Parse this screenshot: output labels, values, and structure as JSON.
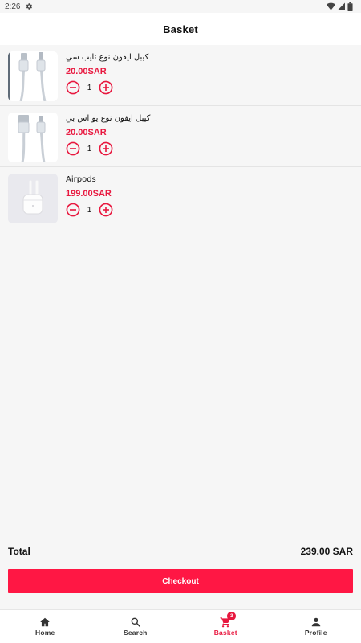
{
  "status_bar": {
    "time": "2:26"
  },
  "header": {
    "title": "Basket"
  },
  "cart": {
    "items": [
      {
        "name": "كيبل ايفون نوع تايب سي",
        "price": "20.00SAR",
        "quantity": "1",
        "image": "cable-usb-c-image"
      },
      {
        "name": "كيبل ايفون نوع يو اس بي",
        "price": "20.00SAR",
        "quantity": "1",
        "image": "cable-usb-a-image"
      },
      {
        "name": "Airpods",
        "price": "199.00SAR",
        "quantity": "1",
        "image": "airpods-image"
      }
    ]
  },
  "summary": {
    "total_label": "Total",
    "total_value": "239.00 SAR"
  },
  "checkout": {
    "label": "Checkout"
  },
  "nav": {
    "items": [
      {
        "label": "Home",
        "icon": "home-icon"
      },
      {
        "label": "Search",
        "icon": "search-icon"
      },
      {
        "label": "Basket",
        "icon": "cart-icon",
        "badge": "3"
      },
      {
        "label": "Profile",
        "icon": "person-icon"
      }
    ],
    "active": "Basket"
  },
  "colors": {
    "accent": "#ff1744",
    "price": "#e8183f",
    "background": "#f6f6f6"
  }
}
